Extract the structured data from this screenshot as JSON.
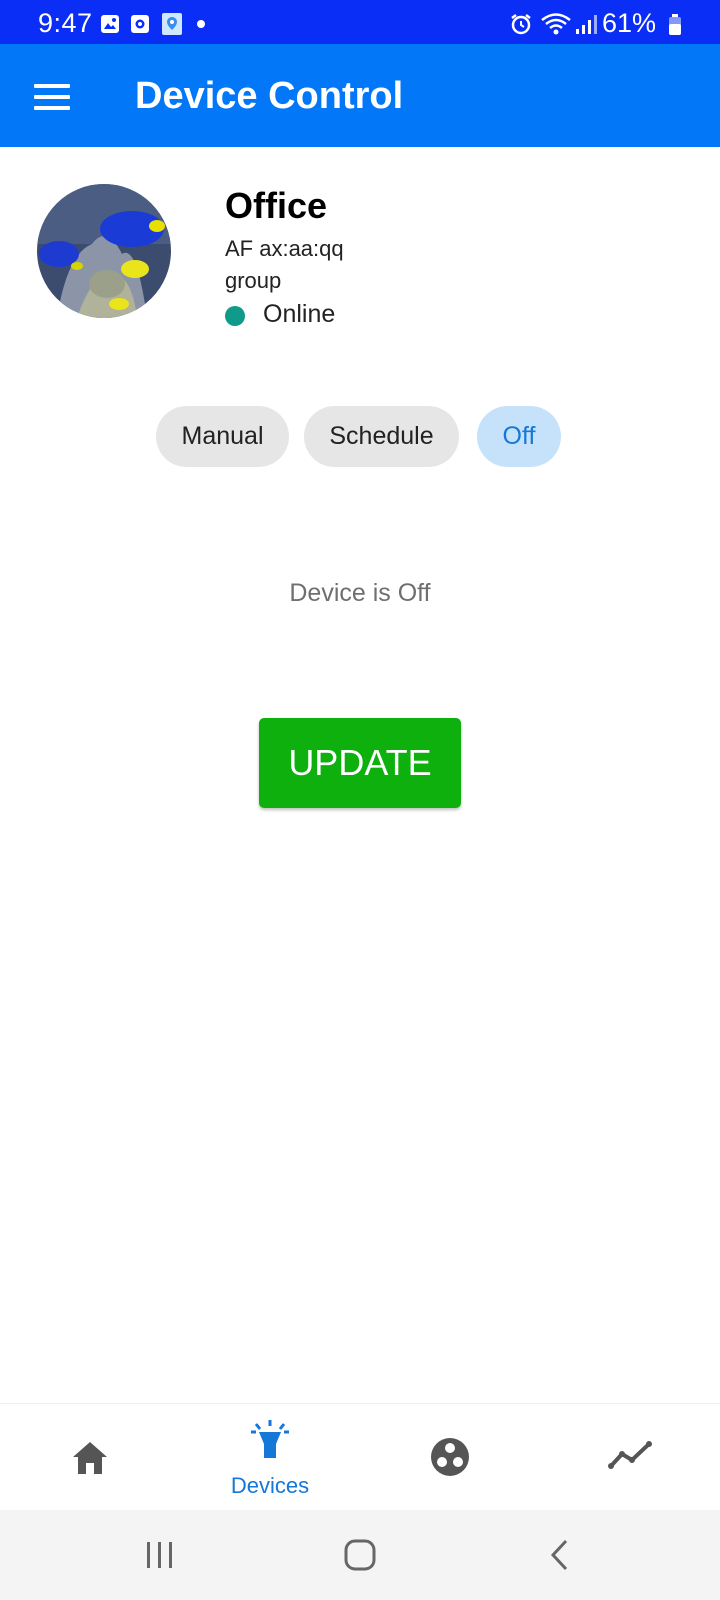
{
  "status_bar": {
    "time": "9:47",
    "battery": "61%",
    "icons": [
      "image-icon",
      "media-icon",
      "location-app-icon",
      "dot-icon",
      "alarm-icon",
      "wifi-icon",
      "signal-icon",
      "battery-icon"
    ],
    "background": "#0a2ef5"
  },
  "app_bar": {
    "title": "Device Control",
    "menu_icon": "menu-icon",
    "background": "#0278f8"
  },
  "device": {
    "name": "Office",
    "id": "AF ax:aa:qq",
    "group": "group",
    "status": "Online",
    "status_color": "#0f9a8a",
    "avatar_icon": "aquarium-fish-photo"
  },
  "modes": {
    "items": [
      {
        "label": "Manual"
      },
      {
        "label": "Schedule"
      },
      {
        "label": "Off"
      }
    ],
    "selected": "Off"
  },
  "state_text": "Device is Off",
  "update_button": {
    "label": "UPDATE",
    "color": "#0db00d"
  },
  "bottom_nav": {
    "items": [
      {
        "icon": "home-icon",
        "label": ""
      },
      {
        "icon": "devices-lamp-icon",
        "label": "Devices"
      },
      {
        "icon": "groups-icon",
        "label": ""
      },
      {
        "icon": "trend-chart-icon",
        "label": ""
      }
    ],
    "active": "Devices",
    "active_color": "#1577d8"
  },
  "system_nav": {
    "icons": [
      "recent-apps-icon",
      "home-circle-icon",
      "back-icon"
    ]
  }
}
